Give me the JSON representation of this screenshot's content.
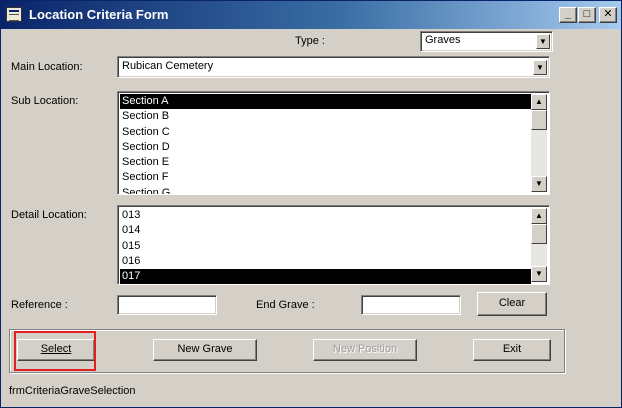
{
  "window": {
    "title": "Location Criteria Form",
    "minimize_glyph": "_",
    "maximize_glyph": "□",
    "close_glyph": "✕"
  },
  "type_field": {
    "label": "Type :",
    "value": "Graves"
  },
  "main_location": {
    "label": "Main Location:",
    "value": "Rubican Cemetery"
  },
  "sub_location": {
    "label": "Sub Location:",
    "items": [
      "Section A",
      "Section B",
      "Section C",
      "Section D",
      "Section E",
      "Section F",
      "Section G"
    ],
    "selected": "Section A"
  },
  "detail_location": {
    "label": "Detail Location:",
    "items": [
      "013",
      "014",
      "015",
      "016",
      "017"
    ],
    "selected": "017"
  },
  "reference": {
    "label": "Reference :",
    "value": ""
  },
  "end_grave": {
    "label": "End Grave :",
    "value": ""
  },
  "buttons": {
    "clear": "Clear",
    "select": "Select",
    "new_grave": "New Grave",
    "new_position": "New Position",
    "exit": "Exit"
  },
  "status_text": "frmCriteriaGraveSelection",
  "colors": {
    "title_gradient_start": "#0a246a",
    "title_gradient_end": "#a6caf0",
    "face": "#d4d0c8",
    "selection": "#000000",
    "highlight_outline": "#e02020"
  },
  "icons": {
    "dropdown": "chevron-down-icon",
    "scroll_up": "chevron-up-icon",
    "scroll_down": "chevron-down-icon"
  }
}
